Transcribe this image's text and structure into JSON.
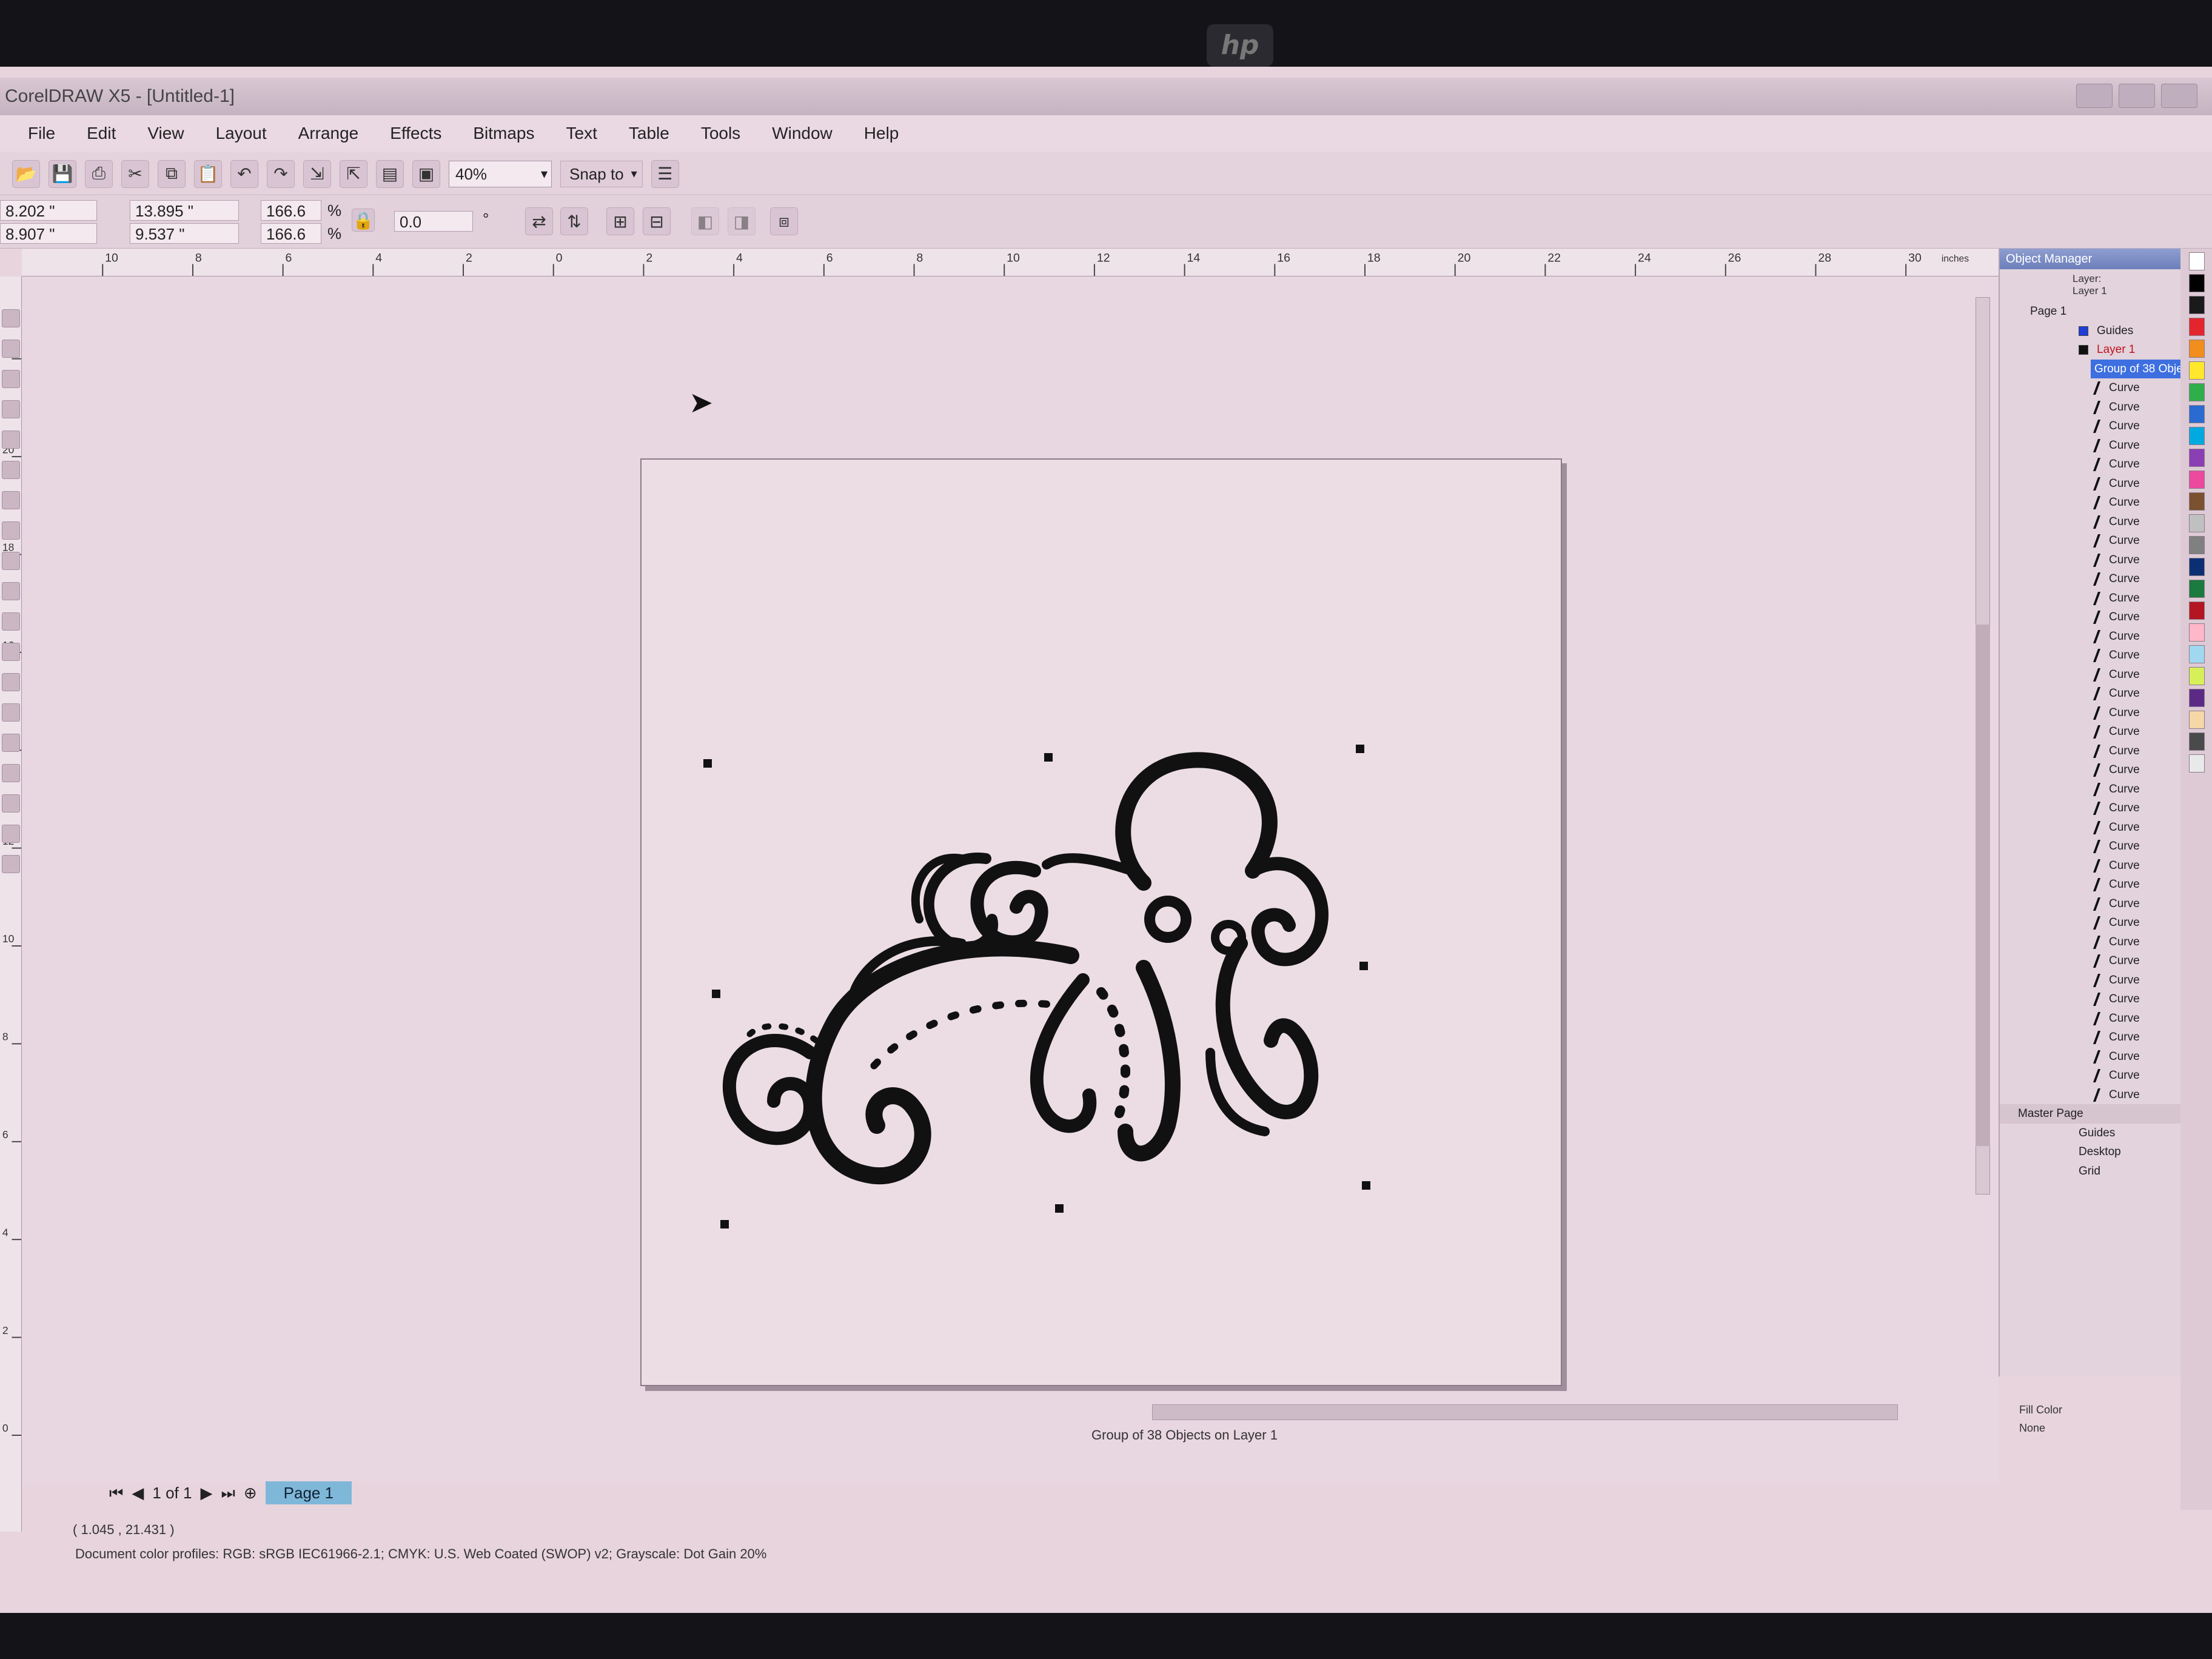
{
  "window": {
    "title": "CorelDRAW X5 - [Untitled-1]"
  },
  "menu": [
    "File",
    "Edit",
    "View",
    "Layout",
    "Arrange",
    "Effects",
    "Bitmaps",
    "Text",
    "Table",
    "Tools",
    "Window",
    "Help"
  ],
  "toolbar": {
    "zoom_value": "40%",
    "snap_label": "Snap to"
  },
  "property_bar": {
    "x": "8.202 \"",
    "y": "8.907 \"",
    "width": "13.895 \"",
    "height": "9.537 \"",
    "scale_x": "166.6",
    "scale_y": "166.6",
    "pct_x": "%",
    "pct_y": "%",
    "rotation": "0.0",
    "degree": "°"
  },
  "rulers": {
    "horizontal_ticks": [
      "10",
      "8",
      "6",
      "4",
      "2",
      "0",
      "2",
      "4",
      "6",
      "8",
      "10",
      "12",
      "14",
      "16",
      "18",
      "20",
      "22",
      "24",
      "26",
      "28",
      "30"
    ],
    "vertical_ticks": [
      "22",
      "20",
      "18",
      "16",
      "14",
      "12",
      "10",
      "8",
      "6",
      "4",
      "2",
      "0"
    ],
    "units": "inches"
  },
  "object_manager": {
    "title": "Object Manager",
    "layer_info_1": "Layer:",
    "layer_info_2": "Layer 1",
    "page_1": "Page 1",
    "guides": "Guides",
    "layer_1": "Layer 1",
    "group": "Group of 38 Objects",
    "curves": [
      "Curve",
      "Curve",
      "Curve",
      "Curve",
      "Curve",
      "Curve",
      "Curve",
      "Curve",
      "Curve",
      "Curve",
      "Curve",
      "Curve",
      "Curve",
      "Curve",
      "Curve",
      "Curve",
      "Curve",
      "Curve",
      "Curve",
      "Curve",
      "Curve",
      "Curve",
      "Curve",
      "Curve",
      "Curve",
      "Curve",
      "Curve",
      "Curve",
      "Curve",
      "Curve",
      "Curve",
      "Curve",
      "Curve",
      "Curve",
      "Curve",
      "Curve",
      "Curve",
      "Curve"
    ],
    "master_page": "Master Page",
    "master_guides": "Guides",
    "master_desktop": "Desktop",
    "master_grid": "Grid",
    "colors": {
      "guides": "#1f3fd6",
      "layer1": "#111111",
      "selection": "#3d6fe0"
    }
  },
  "pager": {
    "position": "1 of 1",
    "tab": "Page 1"
  },
  "status": {
    "object_info": "Group of 38 Objects on Layer 1",
    "coordinates": "( 1.045 , 21.431 )",
    "profiles": "Document color profiles: RGB: sRGB IEC61966-2.1; CMYK: U.S. Web Coated (SWOP) v2; Grayscale: Dot Gain 20%",
    "fill": "Fill Color",
    "outline": "None"
  },
  "palette_colors": [
    "#ffffff",
    "#000000",
    "#1a1a1a",
    "#e3262d",
    "#f18e1d",
    "#ffe82c",
    "#2fae4a",
    "#2a6bd1",
    "#00a9e0",
    "#8a3fb4",
    "#ec4a9c",
    "#7a5230",
    "#c0c0c0",
    "#808080",
    "#0c2f74",
    "#1b7a3d",
    "#b31622",
    "#ffb7c9",
    "#a0d8f0",
    "#d7f05a",
    "#5b2a86",
    "#f5d7a8",
    "#4a4a4a",
    "#e9e9e9"
  ],
  "octopus_color": "#111111"
}
